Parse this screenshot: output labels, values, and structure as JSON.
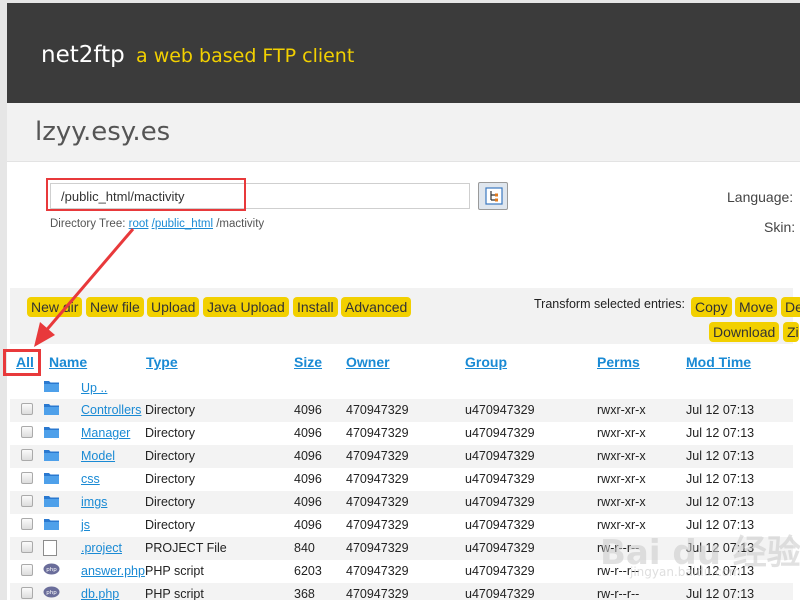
{
  "header": {
    "app_name": "net2ftp",
    "tagline": "a web based FTP client"
  },
  "site": {
    "name": "lzyy.esy.es"
  },
  "directory": {
    "value": "/public_html/mactivity",
    "tree_label": "Directory Tree:",
    "tree_root": "root",
    "tree_parts": [
      "/public_html",
      "/mactivity"
    ]
  },
  "settings": {
    "language_label": "Language:",
    "skin_label": "Skin:"
  },
  "toolbar": {
    "buttons": [
      "New dir",
      "New file",
      "Upload",
      "Java Upload",
      "Install",
      "Advanced"
    ],
    "transform_label": "Transform selected entries:",
    "transform_buttons": [
      "Copy",
      "Move",
      "De",
      "Download",
      "Zi"
    ]
  },
  "table": {
    "headers": {
      "all": "All",
      "name": "Name",
      "type": "Type",
      "size": "Size",
      "owner": "Owner",
      "group": "Group",
      "perms": "Perms",
      "mod_time": "Mod Time"
    },
    "up_label": "Up ..",
    "rows": [
      {
        "icon": "folder-icon",
        "name": "Controllers",
        "type": "Directory",
        "size": "4096",
        "owner": "470947329",
        "group": "u470947329",
        "perms": "rwxr-xr-x",
        "mod_time": "Jul 12 07:13"
      },
      {
        "icon": "folder-icon",
        "name": "Manager",
        "type": "Directory",
        "size": "4096",
        "owner": "470947329",
        "group": "u470947329",
        "perms": "rwxr-xr-x",
        "mod_time": "Jul 12 07:13"
      },
      {
        "icon": "folder-icon",
        "name": "Model",
        "type": "Directory",
        "size": "4096",
        "owner": "470947329",
        "group": "u470947329",
        "perms": "rwxr-xr-x",
        "mod_time": "Jul 12 07:13"
      },
      {
        "icon": "folder-icon",
        "name": "css",
        "type": "Directory",
        "size": "4096",
        "owner": "470947329",
        "group": "u470947329",
        "perms": "rwxr-xr-x",
        "mod_time": "Jul 12 07:13"
      },
      {
        "icon": "folder-icon",
        "name": "imgs",
        "type": "Directory",
        "size": "4096",
        "owner": "470947329",
        "group": "u470947329",
        "perms": "rwxr-xr-x",
        "mod_time": "Jul 12 07:13"
      },
      {
        "icon": "folder-icon",
        "name": "js",
        "type": "Directory",
        "size": "4096",
        "owner": "470947329",
        "group": "u470947329",
        "perms": "rwxr-xr-x",
        "mod_time": "Jul 12 07:13"
      },
      {
        "icon": "file-icon",
        "name": ".project",
        "type": "PROJECT File",
        "size": "840",
        "owner": "470947329",
        "group": "u470947329",
        "perms": "rw-r--r--",
        "mod_time": "Jul 12 07:13"
      },
      {
        "icon": "php-icon",
        "name": "answer.php",
        "type": "PHP script",
        "size": "6203",
        "owner": "470947329",
        "group": "u470947329",
        "perms": "rw-r--r--",
        "mod_time": "Jul 12 07:13"
      },
      {
        "icon": "php-icon",
        "name": "db.php",
        "type": "PHP script",
        "size": "368",
        "owner": "470947329",
        "group": "u470947329",
        "perms": "rw-r--r--",
        "mod_time": "Jul 12 07:13"
      }
    ]
  },
  "watermark": {
    "main": "Bai du 经验",
    "sub": "jingyan.baidu.com"
  },
  "colors": {
    "accent": "#f2d000",
    "link": "#1a8ad4",
    "highlight": "#e8393b",
    "header_bg": "#3b3b3b"
  }
}
